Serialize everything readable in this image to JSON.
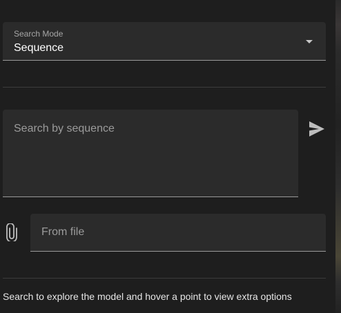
{
  "search_mode": {
    "label": "Search Mode",
    "value": "Sequence"
  },
  "sequence_input": {
    "placeholder": "Search by sequence",
    "value": ""
  },
  "send_icon": "send-icon",
  "attach_icon": "paperclip-icon",
  "file_input": {
    "placeholder": "From file"
  },
  "hint_text": "Search to explore the model and hover a point to view extra options",
  "colors": {
    "background": "#1e1e1e",
    "field_background": "#2b2b2b",
    "text": "#ffffff",
    "muted_text": "#9b9b9b"
  }
}
